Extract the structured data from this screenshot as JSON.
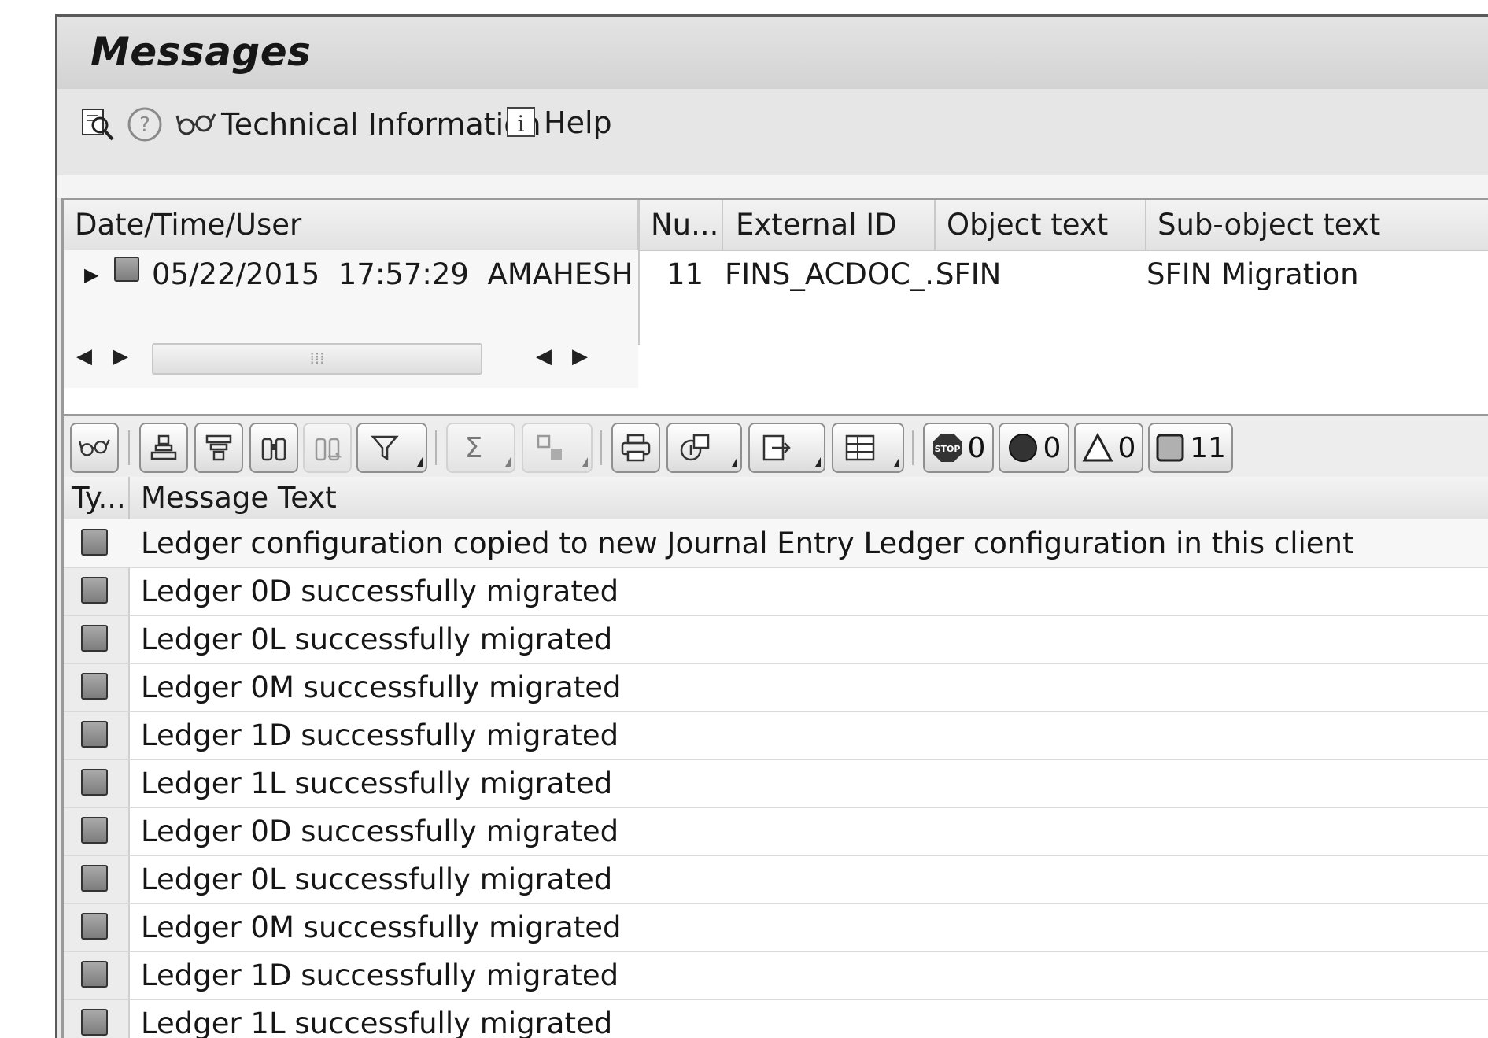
{
  "window": {
    "title": "Messages"
  },
  "appbar": {
    "items": [
      {
        "icon": "detail-search-icon",
        "label": ""
      },
      {
        "icon": "help-circle-icon",
        "label": ""
      },
      {
        "icon": "glasses-icon",
        "label": "Technical Information"
      },
      {
        "icon": "info-icon",
        "label": "Help"
      }
    ]
  },
  "tree": {
    "headers": [
      "Date/Time/User",
      "Nu...",
      "External ID",
      "Object text",
      "Sub-object text"
    ],
    "row": {
      "date": "05/22/2015",
      "time": "17:57:29",
      "user": "AMAHESH",
      "number": "11",
      "external_id": "FINS_ACDOC_...",
      "object_text": "SFIN",
      "subobject_text": "SFIN Migration"
    }
  },
  "alv_toolbar": {
    "counters": {
      "stop": "0",
      "error": "0",
      "warning": "0",
      "info": "11"
    }
  },
  "grid": {
    "headers": {
      "type": "Ty...",
      "message": "Message Text"
    },
    "rows": [
      "Ledger configuration copied to new Journal Entry Ledger configuration in this client",
      "Ledger 0D successfully migrated",
      "Ledger 0L successfully migrated",
      "Ledger 0M successfully migrated",
      "Ledger 1D successfully migrated",
      "Ledger 1L successfully migrated",
      "Ledger 0D successfully migrated",
      "Ledger 0L successfully migrated",
      "Ledger 0M successfully migrated",
      "Ledger 1D successfully migrated",
      "Ledger 1L successfully migrated"
    ]
  }
}
